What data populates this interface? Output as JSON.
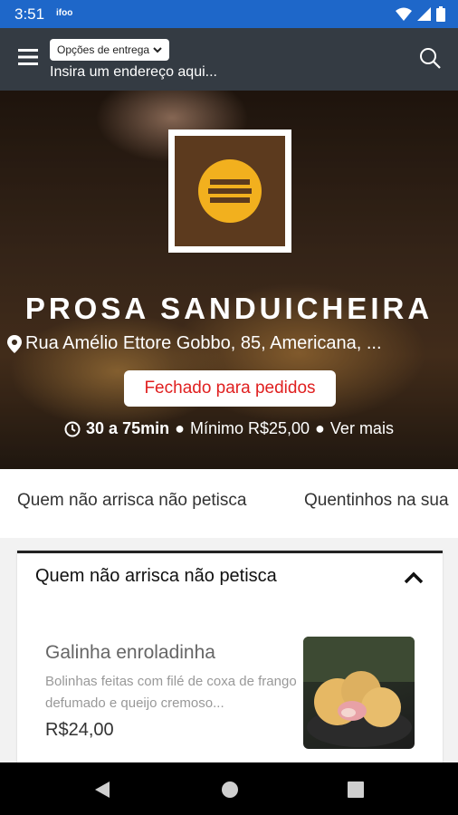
{
  "status_bar": {
    "time": "3:51",
    "app_badge": "ifoo"
  },
  "header": {
    "delivery_options": "Opções de entrega",
    "address_placeholder": "Insira um endereço aqui..."
  },
  "store": {
    "name": "PROSA SANDUICHEIRA",
    "address": "Rua Amélio Ettore Gobbo, 85, Americana, ...",
    "status": "Fechado para pedidos",
    "delivery_time": "30 a 75min",
    "minimum": "Mínimo R$25,00",
    "more": "Ver mais"
  },
  "category_tabs": [
    "Quem não arrisca não petisca",
    "Quentinhos na sua"
  ],
  "section": {
    "title": "Quem não arrisca não petisca",
    "item": {
      "name": "Galinha enroladinha",
      "description": "Bolinhas feitas com filé de coxa de frango defumado e queijo cremoso...",
      "price": "R$24,00"
    }
  },
  "colors": {
    "status_bar": "#1e67c9",
    "header": "#343b43",
    "closed": "#e02020",
    "logo_bg": "#5c3a1e",
    "logo_mark": "#f2b01e"
  },
  "icons": {
    "menu": "menu-icon",
    "search": "search-icon",
    "location": "location-pin-icon",
    "clock": "clock-icon",
    "collapse": "chevron-up-icon"
  }
}
